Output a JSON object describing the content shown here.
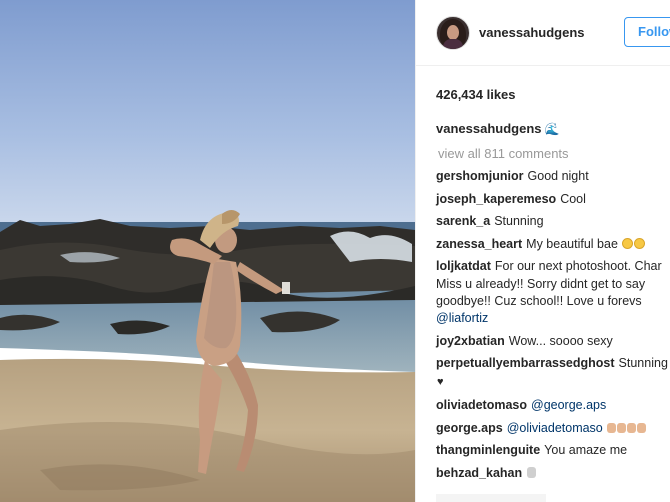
{
  "post": {
    "username": "vanessahudgens",
    "follow_label": "Follow",
    "likes": "426,434 likes",
    "caption_user": "vanessahudgens",
    "caption_emoji": "wave-emoji",
    "view_all": "view all 811 comments"
  },
  "comments": [
    {
      "user": "gershomjunior",
      "text": "Good night"
    },
    {
      "user": "joseph_kaperemeso",
      "text": "Cool"
    },
    {
      "user": "sarenk_a",
      "text": "Stunning"
    },
    {
      "user": "zanessa_heart",
      "text": "My beautiful bae",
      "emoji": "heart-eyes-emoji"
    },
    {
      "user": "loljkatdat",
      "text": "For our next photoshoot. Char Miss u already!! Sorry didnt get to say goodbye!! Cuz school!! Love u forevs",
      "mention": "@liafortiz"
    },
    {
      "user": "joy2xbatian",
      "text": "Wow... soooo sexy"
    },
    {
      "user": "perpetuallyembarrassedghost",
      "text": "Stunning",
      "emoji": "black-heart-emoji"
    },
    {
      "user": "oliviadetomaso",
      "mention": "@george.aps"
    },
    {
      "user": "george.aps",
      "mention": "@oliviadetomaso",
      "emoji": "clapping-hands-emoji"
    },
    {
      "user": "thangminlenguite",
      "text": "You amaze me"
    },
    {
      "user": "behzad_kahan",
      "emoji": "hand-emoji"
    }
  ],
  "colors": {
    "link_blue": "#3897f0",
    "text_dark": "#262626",
    "muted": "#999999",
    "mention": "#003569"
  }
}
